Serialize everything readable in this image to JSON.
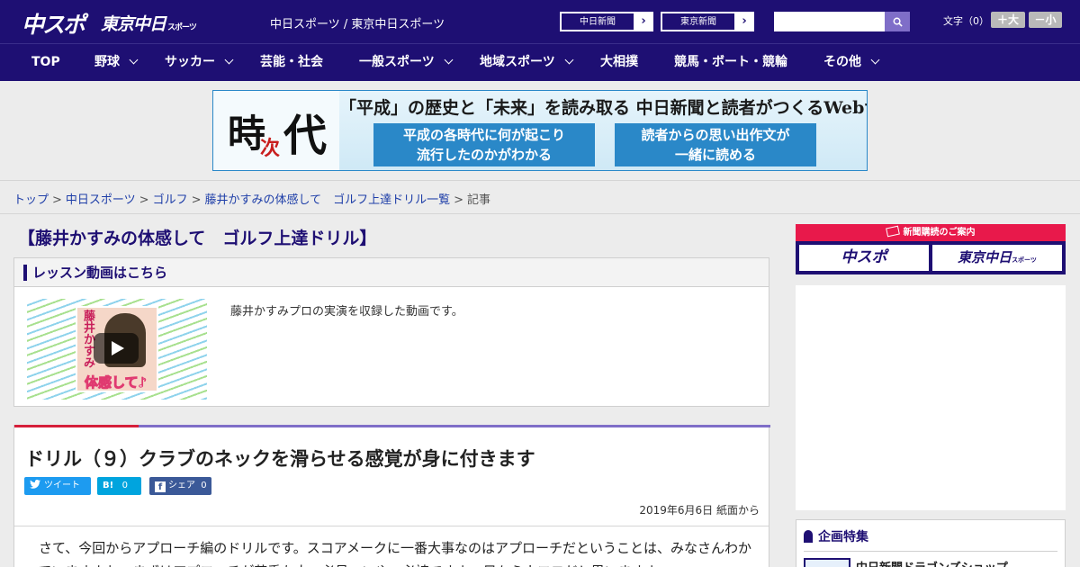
{
  "header": {
    "logo_chuspo": "中スポ",
    "logo_tokyo": "東京中日",
    "logo_tokyo_suffix": "スポーツ",
    "site_title": "中日スポーツ / 東京中日スポーツ",
    "paper_links": [
      "中日新聞",
      "東京新聞"
    ],
    "search_placeholder": "",
    "font_size_label": "文字（0）",
    "font_larger": "＋大",
    "font_smaller": "－小"
  },
  "nav": {
    "items": [
      {
        "label": "TOP",
        "has_dropdown": false
      },
      {
        "label": "野球",
        "has_dropdown": true
      },
      {
        "label": "サッカー",
        "has_dropdown": true
      },
      {
        "label": "芸能・社会",
        "has_dropdown": false
      },
      {
        "label": "一般スポーツ",
        "has_dropdown": true
      },
      {
        "label": "地域スポーツ",
        "has_dropdown": true
      },
      {
        "label": "大相撲",
        "has_dropdown": false
      },
      {
        "label": "競馬・ボート・競輪",
        "has_dropdown": false
      },
      {
        "label": "その他",
        "has_dropdown": true
      }
    ]
  },
  "banner": {
    "logo_ji": "時",
    "logo_tsugi": "次",
    "logo_dai": "代",
    "headline": "「平成」の歴史と「未来」を読み取る 中日新聞と読者がつくるWebサイト",
    "box1": [
      "平成の各時代に何が起こり",
      "流行したのかがわかる"
    ],
    "box2": [
      "読者からの思い出作文が",
      "一緒に読める"
    ]
  },
  "breadcrumb": {
    "items": [
      "トップ",
      "中日スポーツ",
      "ゴルフ",
      "藤井かすみの体感して　ゴルフ上達ドリル一覧"
    ],
    "current": "記事"
  },
  "main": {
    "series_title": "【藤井かすみの体感して　ゴルフ上達ドリル】",
    "lesson_heading": "レッスン動画はこちら",
    "lesson_thumb_name": "藤井かすみ",
    "lesson_thumb_caption": "体感して♪",
    "lesson_desc": "藤井かすみプロの実演を収録した動画です。",
    "headline": "ドリル（９）クラブのネックを滑らせる感覚が身に付きます",
    "share": {
      "tweet": "ツイート",
      "hatena_label": "B!",
      "hatena_count": "0",
      "facebook_label": "シェア",
      "facebook_count": "0"
    },
    "date": "2019年6月6日 紙面から",
    "body": "　さて、今回からアプローチ編のドリルです。スコアメークに一番大事なのはアプローチだということは、みなさんわかっていますよね。まずはアプローチが苦手な人、必見、いや、必読ですよ。目からウロコだと思いますよ。"
  },
  "sidebar": {
    "subscription_heading": "新聞購読のご案内",
    "sub_logo1": "中スポ",
    "sub_logo2": "東京中日",
    "sub_logo2_suffix": "スポーツ",
    "feature_heading": "企画特集",
    "feature_item": "中日新聞ドラゴンズショップ"
  },
  "colors": {
    "brand_navy": "#1e0f73",
    "accent_red": "#d61f3a",
    "accent_purple": "#7f6ec8",
    "twitter": "#1d9bf0",
    "hatena": "#00a4de",
    "facebook": "#3b5998"
  },
  "icons": {
    "search": "search-icon",
    "arrow": "chevron-right-icon",
    "dropdown": "chevron-down-icon",
    "play": "play-icon",
    "twitter": "twitter-bird-icon",
    "facebook": "facebook-icon",
    "newspaper": "newspaper-icon",
    "ribbon": "ribbon-icon"
  }
}
